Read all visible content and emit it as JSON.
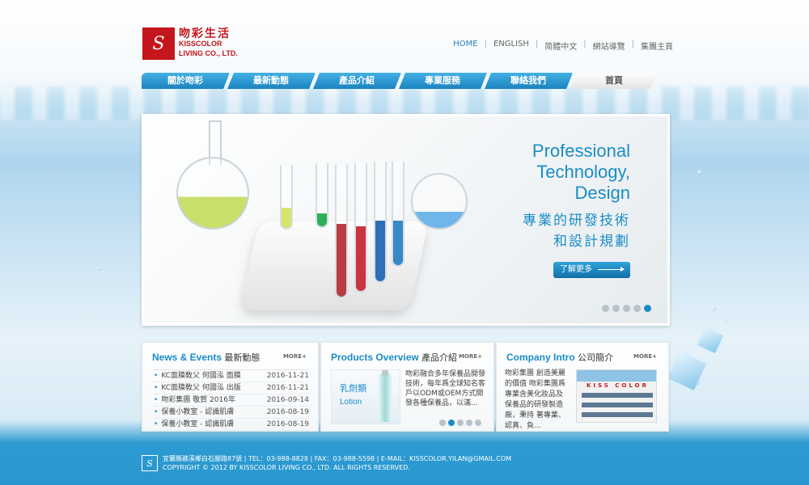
{
  "brand": {
    "logo_mark": "S",
    "name_cn": "吻彩生活",
    "name_en_1": "KISSCOLOR",
    "name_en_2": "LIVING CO., LTD."
  },
  "topnav": [
    "HOME",
    "ENGLISH",
    "简體中文",
    "網站導覽",
    "集團主頁"
  ],
  "mainnav": [
    "關於吻彩",
    "最新動態",
    "產品介紹",
    "專業服務",
    "聯絡我們",
    "首頁"
  ],
  "banner": {
    "title_lines": [
      "Professional",
      "Technology,",
      "Design"
    ],
    "cn_lines": [
      "專業的研發技術",
      "和設計規劃"
    ],
    "more_label": "了解更多"
  },
  "news": {
    "title_en": "News & Events",
    "title_cn": "最新動態",
    "more": "MORE+",
    "items": [
      {
        "title": "KC面膜敎父 何國泓 面膜",
        "date": "2016-11-21"
      },
      {
        "title": "KC面膜敎父 何國泓 出版",
        "date": "2016-11-21"
      },
      {
        "title": "吻彩集團 敬賀 2016年",
        "date": "2016-09-14"
      },
      {
        "title": "保養小教室 - 認識肌膚",
        "date": "2016-08-19"
      },
      {
        "title": "保養小教室 - 認識肌膚",
        "date": "2016-08-19"
      }
    ]
  },
  "products": {
    "title_en": "Products Overview",
    "title_cn": "產品介紹",
    "more": "MORE+",
    "label_cn": "乳劑類",
    "label_en": "Lotion",
    "desc": "吻彩融合多年保養品開發技術，每年爲全球知名客戶以ODM或OEM方式開發各種保養品，以滿..."
  },
  "company": {
    "title_en": "Company Intro",
    "title_cn": "公司簡介",
    "more": "MORE+",
    "desc": "吻彩集團 創造美麗的價值 吻彩集團爲專業含美化妝品及保養品的研發製造廠，秉持 著專業、認真、負...",
    "sign": "KISS COLOR"
  },
  "footer": {
    "line1": "宜蘭縣礁溪鄉白石腳路87號 | TEL：03-988-8828 | FAX：03-988-5598 | E-MAIL：KISSCOLOR.YILAN@GMAIL.COM",
    "line2": "COPYRIGHT © 2012 BY KISSCOLOR LIVING CO., LTD. ALL RIGHTS RESERVED."
  },
  "colors": {
    "brand_red": "#c4161c",
    "accent_blue": "#1a8cc8",
    "footer_blue": "#2a97cf"
  }
}
